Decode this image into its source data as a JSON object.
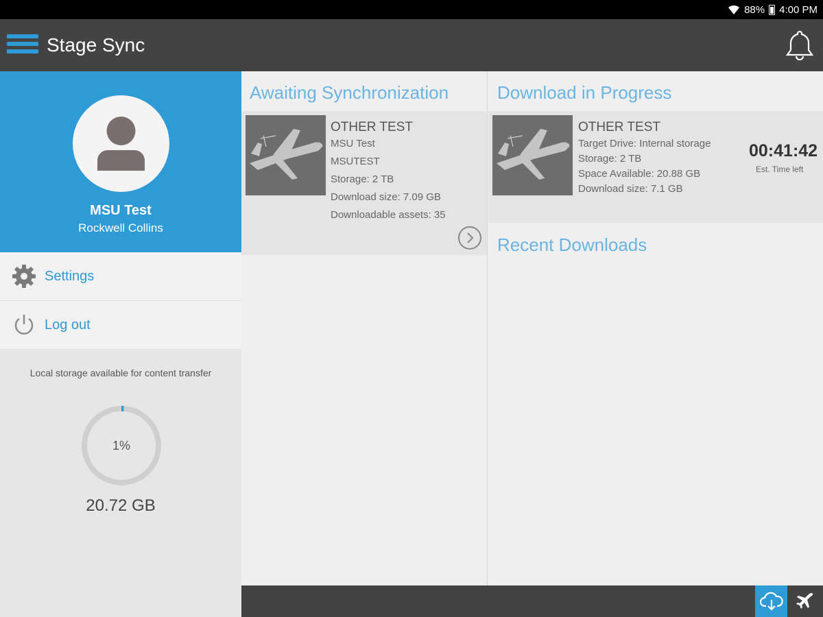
{
  "status_bar": {
    "battery": "88%",
    "time": "4:00 PM"
  },
  "app_bar": {
    "title": "Stage Sync"
  },
  "sidebar": {
    "user_name": "MSU Test",
    "user_org": "Rockwell Collins",
    "items": [
      {
        "label": "Settings",
        "icon": "gear-icon"
      },
      {
        "label": "Log out",
        "icon": "power-icon"
      }
    ],
    "storage": {
      "label": "Local storage available for content transfer",
      "percent_text": "1%",
      "percent_value": 1,
      "available": "20.72 GB"
    }
  },
  "awaiting": {
    "title": "Awaiting Synchronization",
    "card": {
      "title": "OTHER TEST",
      "lines": [
        "MSU Test",
        "MSUTEST",
        "Storage: 2 TB",
        "Download size: 7.09 GB",
        "Downloadable assets: 35"
      ]
    }
  },
  "progress": {
    "title": "Download in Progress",
    "card": {
      "title": "OTHER TEST",
      "lines": [
        "Target Drive:  Internal storage",
        "Storage:  2 TB",
        "Space Available:  20.88 GB",
        "Download size:  7.1 GB"
      ],
      "timer": "00:41:42",
      "timer_label": "Est. Time left"
    }
  },
  "recent": {
    "title": "Recent Downloads"
  },
  "colors": {
    "accent": "#2e9ad6",
    "bar": "#434343",
    "title_blue": "#6ab4e2"
  }
}
